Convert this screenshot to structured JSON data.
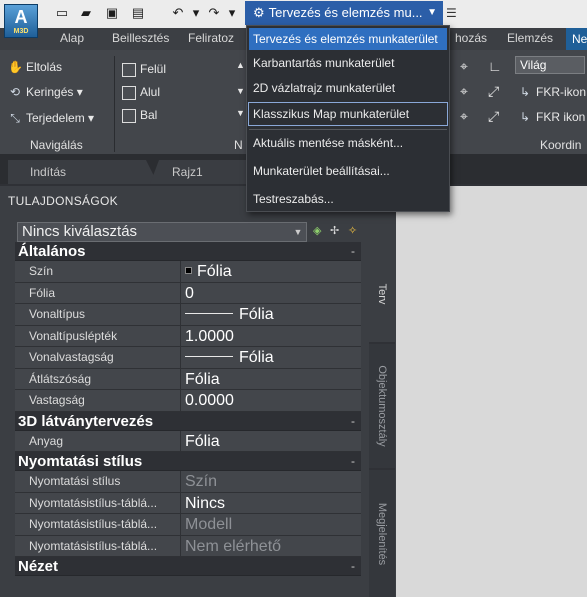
{
  "app": {
    "logo_letter": "A",
    "logo_sub": "M3D"
  },
  "qat": {
    "workspace_label": "Tervezés és elemzés mu..."
  },
  "ribbon_tabs": [
    "Alap",
    "Beillesztés",
    "Feliratoz",
    "hozás",
    "Elemzés",
    "Ne"
  ],
  "ribbon": {
    "navigation": {
      "pan": "Eltolás",
      "orbit": "Keringés",
      "extents": "Terjedelem",
      "title": "Navigálás"
    },
    "views": {
      "top": "Felül",
      "bottom": "Alul",
      "left": "Bal",
      "title_partial": "N"
    },
    "coords": {
      "world": "Világ",
      "ucs_icon": "FKR-ikon",
      "ucs_props": "FKR ikon tula",
      "title": "Koordin"
    }
  },
  "file_tabs": {
    "start": "Indítás",
    "drawing": "Rajz1"
  },
  "properties": {
    "title": "TULAJDONSÁGOK",
    "selection": "Nincs kiválasztás",
    "side_tabs": [
      "Terv",
      "Objektumosztály",
      "Megjelenítés"
    ],
    "categories": [
      {
        "name": "Általános",
        "rows": [
          {
            "k": "Szín",
            "v": "Fólia",
            "kind": "swatch"
          },
          {
            "k": "Fólia",
            "v": "0"
          },
          {
            "k": "Vonaltípus",
            "v": "Fólia",
            "kind": "line"
          },
          {
            "k": "Vonaltípuslépték",
            "v": "1.0000"
          },
          {
            "k": "Vonalvastagság",
            "v": "Fólia",
            "kind": "line"
          },
          {
            "k": "Átlátszóság",
            "v": "Fólia"
          },
          {
            "k": "Vastagság",
            "v": "0.0000"
          }
        ]
      },
      {
        "name": "3D látványtervezés",
        "rows": [
          {
            "k": "Anyag",
            "v": "Fólia"
          }
        ]
      },
      {
        "name": "Nyomtatási stílus",
        "rows": [
          {
            "k": "Nyomtatási stílus",
            "v": "Szín",
            "dim": true
          },
          {
            "k": "Nyomtatásistílus-táblá...",
            "v": "Nincs"
          },
          {
            "k": "Nyomtatásistílus-táblá...",
            "v": "Modell",
            "dim": true
          },
          {
            "k": "Nyomtatásistílus-táblá...",
            "v": "Nem elérhető",
            "dim": true
          }
        ]
      },
      {
        "name": "Nézet",
        "rows": []
      }
    ]
  },
  "menu": {
    "items": [
      {
        "label": "Tervezés és elemzés munkaterület",
        "selected": true
      },
      {
        "label": "Karbantartás munkaterület"
      },
      {
        "label": "2D vázlatrajz munkaterület"
      },
      {
        "label": "Klasszikus Map munkaterület",
        "boxed": true
      },
      {
        "label": "Aktuális mentése másként..."
      },
      {
        "label": "Munkaterület beállításai..."
      },
      {
        "label": "Testreszabás..."
      }
    ]
  }
}
